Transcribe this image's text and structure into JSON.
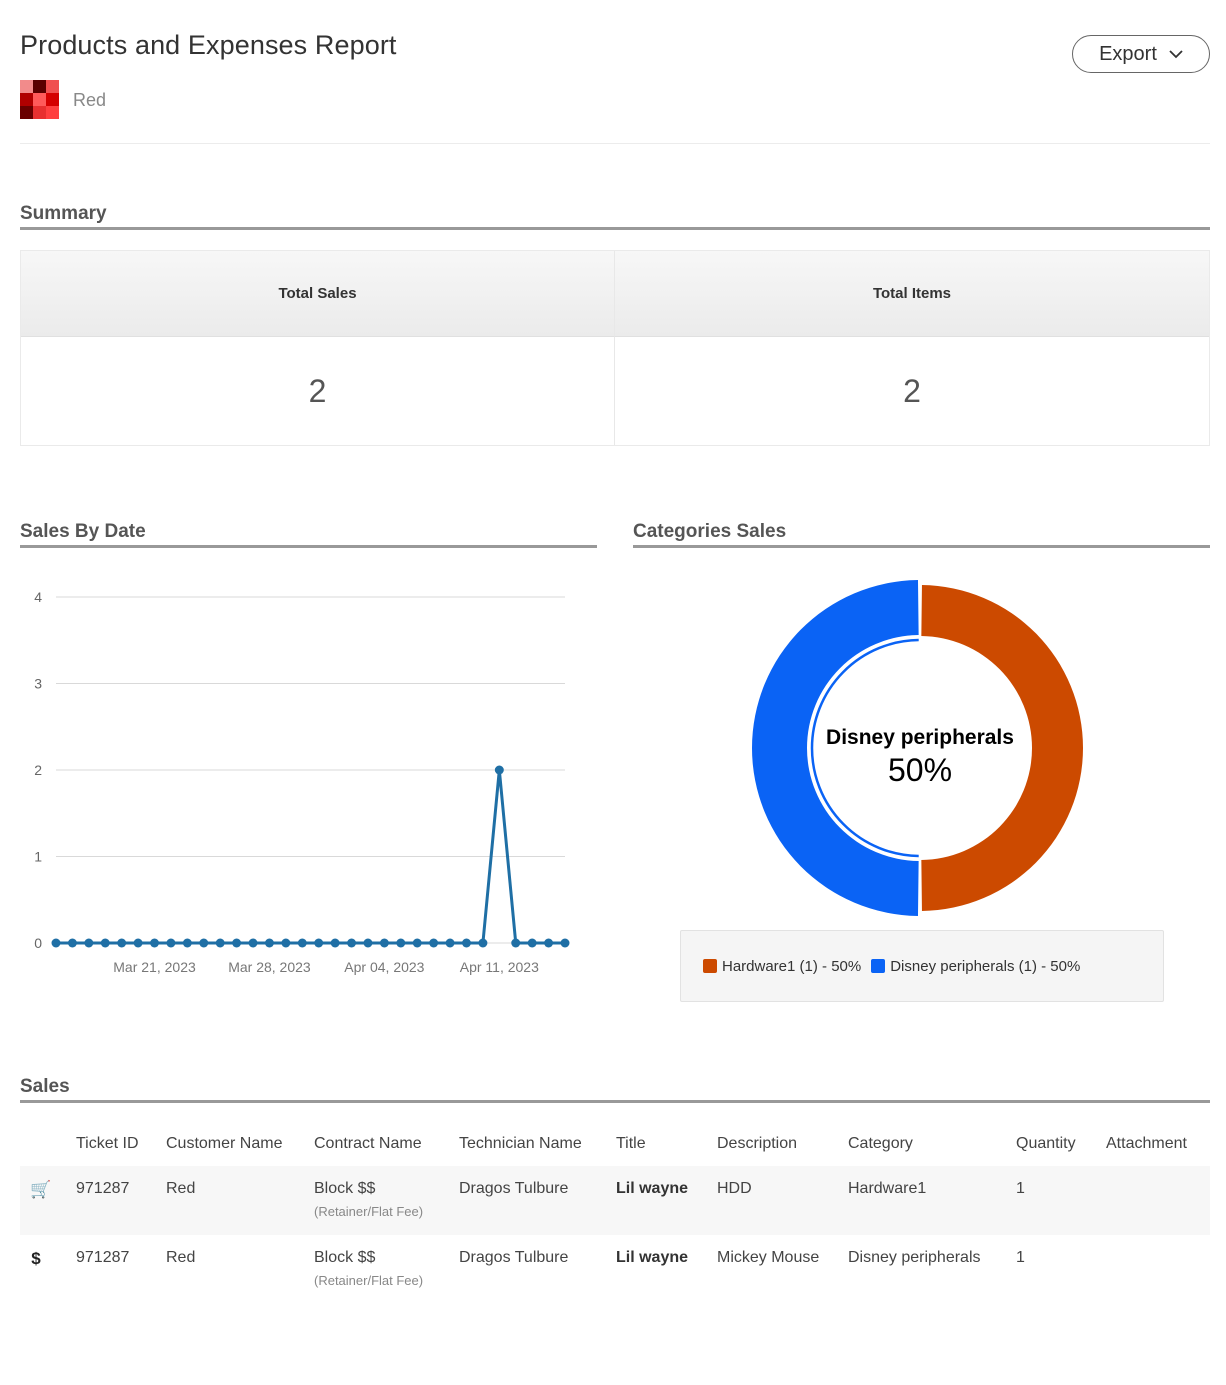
{
  "header": {
    "title": "Products and Expenses Report",
    "client_name": "Red",
    "export_label": "Export"
  },
  "summary": {
    "section_title": "Summary",
    "total_sales_label": "Total Sales",
    "total_sales_value": "2",
    "total_items_label": "Total Items",
    "total_items_value": "2"
  },
  "sales_by_date": {
    "section_title": "Sales By Date"
  },
  "categories_sales": {
    "section_title": "Categories Sales",
    "center_label": "Disney peripherals",
    "center_value": "50%",
    "legend": [
      {
        "label": "Hardware1 (1) - 50%",
        "color": "#cc4a00"
      },
      {
        "label": "Disney peripherals (1) - 50%",
        "color": "#0a63f5"
      }
    ]
  },
  "chart_data": [
    {
      "type": "line",
      "title": "Sales By Date",
      "x_tick_labels": [
        "Mar 21, 2023",
        "Mar 28, 2023",
        "Apr 04, 2023",
        "Apr 11, 2023"
      ],
      "x_range": [
        "2023-03-15",
        "2023-04-15"
      ],
      "ylim": [
        0,
        4
      ],
      "y_ticks": [
        0,
        1,
        2,
        3,
        4
      ],
      "grid": true,
      "color": "#1f6fa5",
      "series": [
        {
          "x": [
            "2023-03-15",
            "2023-03-16",
            "2023-03-17",
            "2023-03-18",
            "2023-03-19",
            "2023-03-20",
            "2023-03-21",
            "2023-03-22",
            "2023-03-23",
            "2023-03-24",
            "2023-03-25",
            "2023-03-26",
            "2023-03-27",
            "2023-03-28",
            "2023-03-29",
            "2023-03-30",
            "2023-03-31",
            "2023-04-01",
            "2023-04-02",
            "2023-04-03",
            "2023-04-04",
            "2023-04-05",
            "2023-04-06",
            "2023-04-07",
            "2023-04-08",
            "2023-04-09",
            "2023-04-10",
            "2023-04-11",
            "2023-04-12",
            "2023-04-13",
            "2023-04-14",
            "2023-04-15"
          ],
          "values": [
            0,
            0,
            0,
            0,
            0,
            0,
            0,
            0,
            0,
            0,
            0,
            0,
            0,
            0,
            0,
            0,
            0,
            0,
            0,
            0,
            0,
            0,
            0,
            0,
            0,
            0,
            0,
            2,
            0,
            0,
            0,
            0
          ]
        }
      ]
    },
    {
      "type": "pie",
      "title": "Categories Sales",
      "categories": [
        "Hardware1",
        "Disney peripherals"
      ],
      "values": [
        1,
        1
      ],
      "percentages": [
        50,
        50
      ],
      "colors": [
        "#cc4a00",
        "#0a63f5"
      ],
      "highlighted": "Disney peripherals"
    }
  ],
  "sales": {
    "section_title": "Sales",
    "columns": [
      "Ticket ID",
      "Customer Name",
      "Contract Name",
      "Technician Name",
      "Title",
      "Description",
      "Category",
      "Quantity",
      "Attachment"
    ],
    "rows": [
      {
        "icon": "cart-icon",
        "icon_glyph": "🛒",
        "ticket_id": "971287",
        "customer": "Red",
        "contract": "Block $$",
        "contract_sub": "(Retainer/Flat Fee)",
        "technician": "Dragos Tulbure",
        "title": "Lil wayne",
        "description": "HDD",
        "category": "Hardware1",
        "quantity": "1",
        "attachment": ""
      },
      {
        "icon": "dollar-icon",
        "icon_glyph": "$",
        "ticket_id": "971287",
        "customer": "Red",
        "contract": "Block $$",
        "contract_sub": "(Retainer/Flat Fee)",
        "technician": "Dragos Tulbure",
        "title": "Lil wayne",
        "description": "Mickey Mouse",
        "category": "Disney peripherals",
        "quantity": "1",
        "attachment": ""
      }
    ]
  }
}
